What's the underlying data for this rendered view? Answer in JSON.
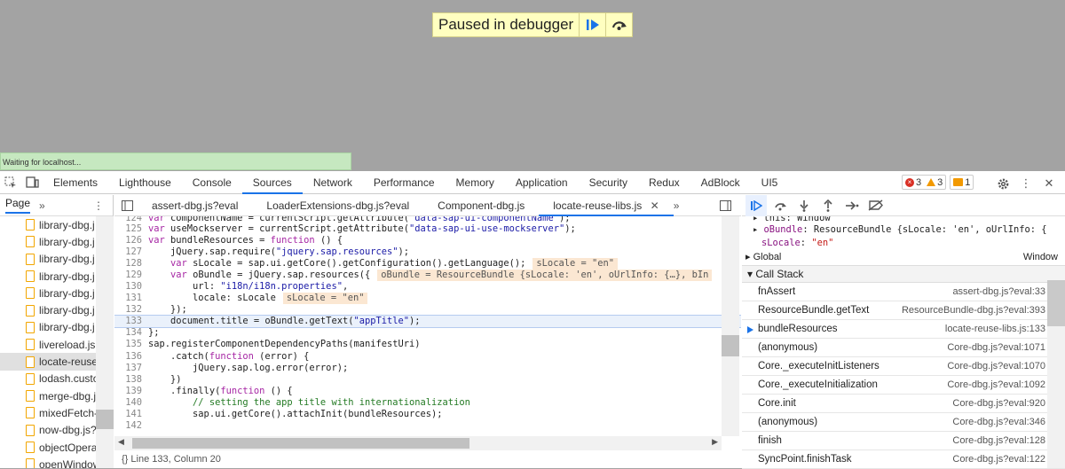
{
  "paused_overlay": {
    "text": "Paused in debugger"
  },
  "status_bar": {
    "text": "Waiting for localhost..."
  },
  "devtools_tabs": [
    "Elements",
    "Lighthouse",
    "Console",
    "Sources",
    "Network",
    "Performance",
    "Memory",
    "Application",
    "Security",
    "Redux",
    "AdBlock",
    "UI5"
  ],
  "active_tab": "Sources",
  "issue_counts": {
    "errors": "3",
    "warnings": "3",
    "info": "1"
  },
  "navigator": {
    "title": "Page",
    "files": [
      "library-dbg.j",
      "library-dbg.j",
      "library-dbg.j",
      "library-dbg.j",
      "library-dbg.j",
      "library-dbg.j",
      "library-dbg.j",
      "livereload.js",
      "locate-reuse",
      "lodash.custo",
      "merge-dbg.j",
      "mixedFetch-",
      "now-dbg.js?",
      "objectOpera",
      "openWindow"
    ],
    "selected_index": 8
  },
  "editor": {
    "tabs": [
      "assert-dbg.js?eval",
      "LoaderExtensions-dbg.js?eval",
      "Component-dbg.js",
      "locate-reuse-libs.js"
    ],
    "active_tab_index": 3,
    "current_line": "133",
    "lines": [
      {
        "n": "124",
        "code": "var componentName = currentScript.getAttribute(\"data-sap-ui-componentName\");"
      },
      {
        "n": "125",
        "code": "var useMockserver = currentScript.getAttribute(\"data-sap-ui-use-mockserver\");"
      },
      {
        "n": "126",
        "code": "var bundleResources = function () {"
      },
      {
        "n": "127",
        "code": "    jQuery.sap.require(\"jquery.sap.resources\");"
      },
      {
        "n": "128",
        "code": "    var sLocale = sap.ui.getCore().getConfiguration().getLanguage();",
        "val": "sLocale = \"en\""
      },
      {
        "n": "129",
        "code": "    var oBundle = jQuery.sap.resources({",
        "val": "oBundle = ResourceBundle {sLocale: 'en', oUrlInfo: {…}, bIn"
      },
      {
        "n": "130",
        "code": "        url: \"i18n/i18n.properties\","
      },
      {
        "n": "131",
        "code": "        locale: sLocale",
        "val": "sLocale = \"en\""
      },
      {
        "n": "132",
        "code": "    });"
      },
      {
        "n": "133",
        "code": "    document.title = oBundle.getText(\"appTitle\");"
      },
      {
        "n": "134",
        "code": "};"
      },
      {
        "n": "135",
        "code": "sap.registerComponentDependencyPaths(manifestUri)"
      },
      {
        "n": "136",
        "code": "    .catch(function (error) {"
      },
      {
        "n": "137",
        "code": "        jQuery.sap.log.error(error);"
      },
      {
        "n": "138",
        "code": "    })"
      },
      {
        "n": "139",
        "code": "    .finally(function () {"
      },
      {
        "n": "140",
        "code": "        // setting the app title with internationalization"
      },
      {
        "n": "141",
        "code": "        sap.ui.getCore().attachInit(bundleResources);"
      },
      {
        "n": "142",
        "code": ""
      }
    ],
    "footer": "{}  Line 133, Column 20"
  },
  "scope": {
    "this_row": "this: Window",
    "bundle_key": "oBundle",
    "bundle_val": "ResourceBundle {sLocale: 'en', oUrlInfo: {",
    "slocale_key": "sLocale",
    "slocale_val": "\"en\"",
    "global_label": "Global",
    "global_val": "Window"
  },
  "call_stack": {
    "title": "Call Stack",
    "current_index": 2,
    "frames": [
      {
        "fn": "fnAssert",
        "loc": "assert-dbg.js?eval:33"
      },
      {
        "fn": "ResourceBundle.getText",
        "loc": "ResourceBundle-dbg.js?eval:393"
      },
      {
        "fn": "bundleResources",
        "loc": "locate-reuse-libs.js:133"
      },
      {
        "fn": "(anonymous)",
        "loc": "Core-dbg.js?eval:1071"
      },
      {
        "fn": "Core._executeInitListeners",
        "loc": "Core-dbg.js?eval:1070"
      },
      {
        "fn": "Core._executeInitialization",
        "loc": "Core-dbg.js?eval:1092"
      },
      {
        "fn": "Core.init",
        "loc": "Core-dbg.js?eval:920"
      },
      {
        "fn": "(anonymous)",
        "loc": "Core-dbg.js?eval:346"
      },
      {
        "fn": "finish",
        "loc": "Core-dbg.js?eval:128"
      },
      {
        "fn": "SyncPoint.finishTask",
        "loc": "Core-dbg.js?eval:122"
      }
    ]
  },
  "colors": {
    "accent": "#1a73e8",
    "paused_bg": "#ffffc0",
    "value_bg": "#fbe7d2"
  }
}
